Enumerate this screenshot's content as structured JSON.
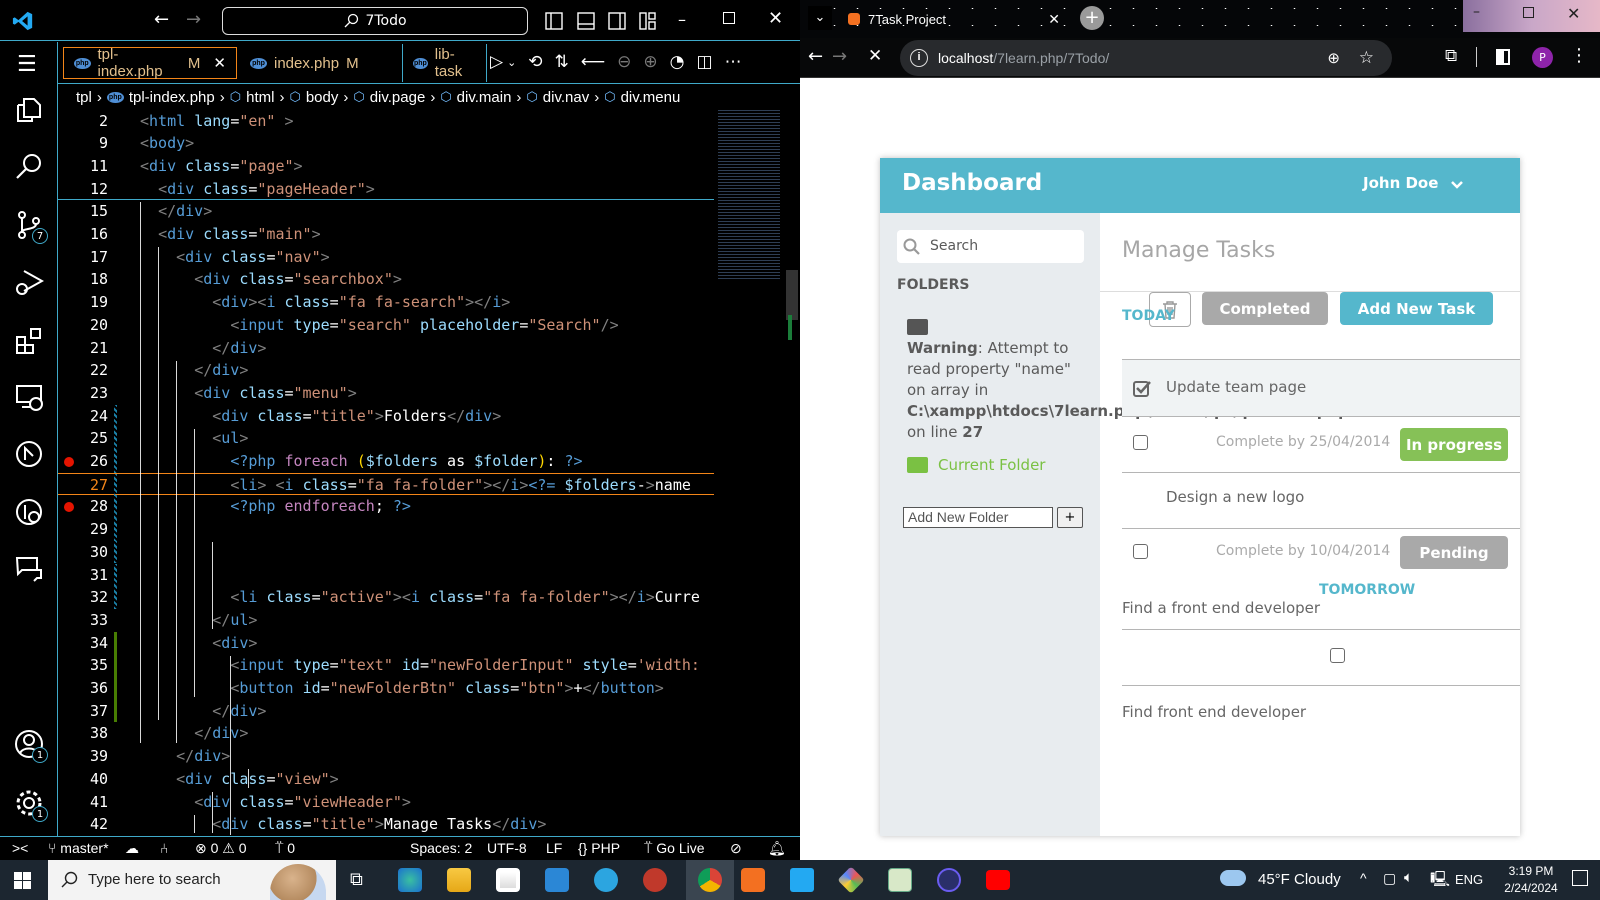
{
  "vscode": {
    "command_center": "7Todo",
    "tabs": [
      {
        "label": "tpl-index.php",
        "status": "M",
        "active": true
      },
      {
        "label": "index.php",
        "status": "M"
      },
      {
        "label": "lib-task"
      }
    ],
    "breadcrumbs": [
      "tpl",
      "tpl-index.php",
      "html",
      "body",
      "div.page",
      "div.main",
      "div.nav",
      "div.menu"
    ],
    "activity_badges": {
      "source_control": "7",
      "accounts": "1",
      "settings": "1"
    },
    "code": [
      {
        "n": "2",
        "text": "<html lang=\"en\" >"
      },
      {
        "n": "9",
        "text": "<body>"
      },
      {
        "n": "11",
        "text": "<div class=\"page\">"
      },
      {
        "n": "12",
        "text": "  <div class=\"pageHeader\">"
      },
      {
        "n": "15",
        "text": "  </div>"
      },
      {
        "n": "16",
        "text": "  <div class=\"main\">"
      },
      {
        "n": "17",
        "text": "    <div class=\"nav\">"
      },
      {
        "n": "18",
        "text": "      <div class=\"searchbox\">"
      },
      {
        "n": "19",
        "text": "        <div><i class=\"fa fa-search\"></i>"
      },
      {
        "n": "20",
        "text": "          <input type=\"search\" placeholder=\"Search\"/>"
      },
      {
        "n": "21",
        "text": "        </div>"
      },
      {
        "n": "22",
        "text": "      </div>"
      },
      {
        "n": "23",
        "text": "      <div class=\"menu\">"
      },
      {
        "n": "24",
        "text": "        <div class=\"title\">Folders</div>"
      },
      {
        "n": "25",
        "text": "        <ul>"
      },
      {
        "n": "26",
        "text": "          <?php foreach ($folders as $folder): ?>",
        "breakpoint": true
      },
      {
        "n": "27",
        "text": "          <li> <i class=\"fa fa-folder\"></i><?= $folders->name",
        "current": true
      },
      {
        "n": "28",
        "text": "          <?php endforeach; ?>",
        "breakpoint": true
      },
      {
        "n": "29",
        "text": ""
      },
      {
        "n": "30",
        "text": ""
      },
      {
        "n": "31",
        "text": ""
      },
      {
        "n": "32",
        "text": "          <li class=\"active\"><i class=\"fa fa-folder\"></i>Curre"
      },
      {
        "n": "33",
        "text": "        </ul>"
      },
      {
        "n": "34",
        "text": "        <div>"
      },
      {
        "n": "35",
        "text": "          <input type=\"text\" id=\"newFolderInput\" style='width:"
      },
      {
        "n": "36",
        "text": "          <button id=\"newFolderBtn\" class=\"btn\">+</button>"
      },
      {
        "n": "37",
        "text": "        </div>"
      },
      {
        "n": "38",
        "text": "      </div>"
      },
      {
        "n": "39",
        "text": "    </div>"
      },
      {
        "n": "40",
        "text": "    <div class=\"view\">"
      },
      {
        "n": "41",
        "text": "      <div class=\"viewHeader\">"
      },
      {
        "n": "42",
        "text": "        <div class=\"title\">Manage Tasks</div>"
      }
    ],
    "status": {
      "branch": "master*",
      "errors": "0",
      "warnings": "0",
      "ports": "0",
      "spaces": "Spaces: 2",
      "encoding": "UTF-8",
      "eol": "LF",
      "language": "PHP",
      "go_live": "Go Live"
    }
  },
  "browser": {
    "tab_title": "7Task Project",
    "url_host": "localhost",
    "url_path": "/7learn.php/7Todo/",
    "profile_initial": "P",
    "page": {
      "title": "Dashboard",
      "user": "John Doe",
      "search_placeholder": "Search",
      "folders_heading": "FOLDERS",
      "warning": {
        "label": "Warning",
        "message": ": Attempt to read property \"name\" on array in ",
        "path": "C:\\xampp\\htdocs\\7learn.php\\7Todo\\tpl\\tpl-index.php",
        "middle": " on line ",
        "line": "27"
      },
      "current_folder": "Current Folder",
      "new_folder_placeholder": "Add New Folder",
      "new_folder_button": "+",
      "view_title": "Manage Tasks",
      "completed_button": "Completed",
      "add_task_button": "Add New Task",
      "today": "TODAY",
      "tomorrow": "TOMORROW",
      "tasks": [
        {
          "title": "Update team page",
          "checked": true
        },
        {
          "due": "Complete by 25/04/2014",
          "status": "In progress"
        },
        {
          "title": "Design a new logo"
        },
        {
          "due": "Complete by 10/04/2014",
          "status": "Pending"
        },
        {
          "title": "Find a front end developer"
        },
        {
          "title": "Find front end developer"
        }
      ],
      "colors": {
        "header": "#55b7cc",
        "in_progress": "#86c157",
        "pending": "#a9a9a9",
        "folder_active": "#7ac143"
      }
    }
  },
  "taskbar": {
    "search_placeholder": "Type here to search",
    "weather": "45°F  Cloudy",
    "language": "ENG",
    "time": "3:19 PM",
    "date": "2/24/2024"
  }
}
